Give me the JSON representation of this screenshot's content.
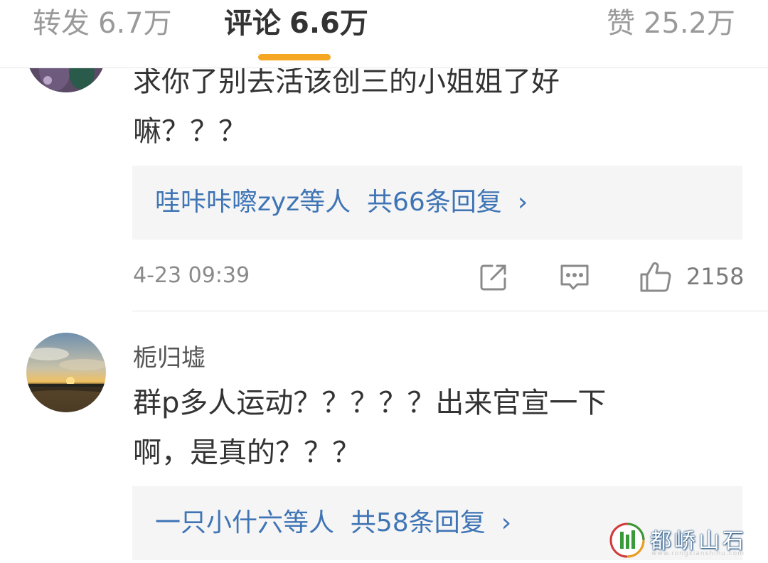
{
  "colors": {
    "accent": "#f5a623",
    "link": "#3f74b5",
    "text": "#333333",
    "muted": "#8a8a8a",
    "reply_bg": "#f5f5f5"
  },
  "tabs": {
    "repost": {
      "label": "转发",
      "count": "6.7万"
    },
    "comment": {
      "label": "评论",
      "count": "6.6万"
    },
    "like": {
      "label": "赞",
      "count": "25.2万"
    }
  },
  "comments": [
    {
      "avatar_icon": "user-avatar",
      "body_lines": [
        "求你了别去活该创三的小姐姐了好",
        "嘛？？？"
      ],
      "reply": {
        "users": "哇咔咔嚓zyz等人",
        "summary": "共66条回复",
        "chevron": "›"
      },
      "time": "4-23 09:39",
      "actions": {
        "share_icon": "share-icon",
        "comment_icon": "comment-icon",
        "like_icon": "thumbs-up-icon",
        "like_count": "2158"
      }
    },
    {
      "avatar_icon": "sunset-avatar",
      "username": "栀归墟",
      "body_lines": [
        "群p多人运动？？？？？出来官宣一下",
        "啊，是真的？？？"
      ],
      "reply": {
        "users": "一只小什六等人",
        "summary": "共58条回复",
        "chevron": "›"
      },
      "time": "",
      "actions": {}
    }
  ],
  "watermark": {
    "text": "都峤山石",
    "url": "www.rongxianshihu.com"
  }
}
